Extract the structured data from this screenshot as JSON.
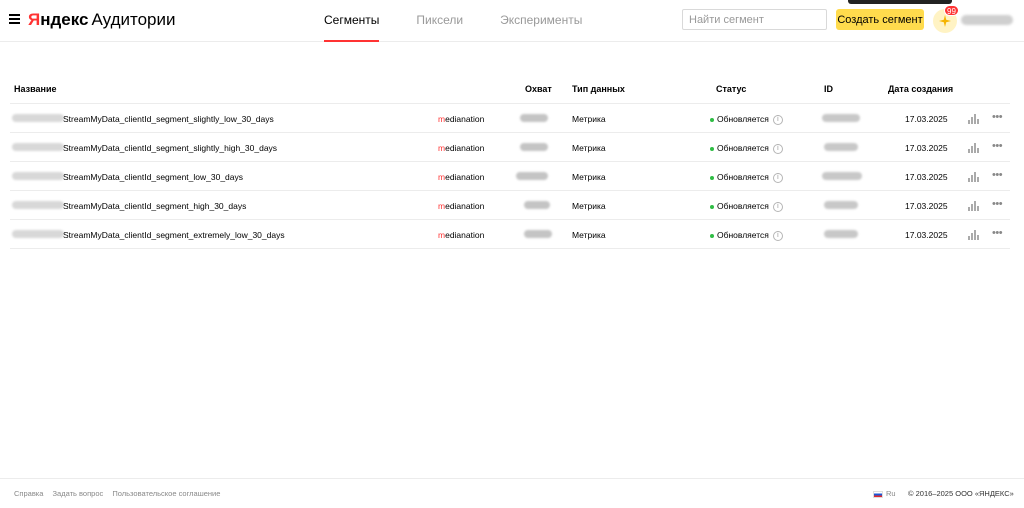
{
  "header": {
    "logo_brand_first": "Я",
    "logo_brand_rest": "ндекс",
    "logo_product": "Аудитории",
    "tabs": [
      {
        "label": "Сегменты",
        "active": true
      },
      {
        "label": "Пиксели",
        "active": false
      },
      {
        "label": "Эксперименты",
        "active": false
      }
    ],
    "search_placeholder": "Найти сегмент",
    "create_button": "Создать сегмент",
    "notification_count": "99"
  },
  "table": {
    "headers": {
      "name": "Название",
      "reach": "Охват",
      "data_type": "Тип данных",
      "status": "Статус",
      "id": "ID",
      "created": "Дата создания"
    },
    "rows": [
      {
        "name": "StreamMyData_clientId_segment_slightly_low_30_days",
        "owner_first": "m",
        "owner_rest": "edianation",
        "data_type": "Метрика",
        "status": "Обновляется",
        "date": "17.03.2025"
      },
      {
        "name": "StreamMyData_clientId_segment_slightly_high_30_days",
        "owner_first": "m",
        "owner_rest": "edianation",
        "data_type": "Метрика",
        "status": "Обновляется",
        "date": "17.03.2025"
      },
      {
        "name": "StreamMyData_clientId_segment_low_30_days",
        "owner_first": "m",
        "owner_rest": "edianation",
        "data_type": "Метрика",
        "status": "Обновляется",
        "date": "17.03.2025"
      },
      {
        "name": "StreamMyData_clientId_segment_high_30_days",
        "owner_first": "m",
        "owner_rest": "edianation",
        "data_type": "Метрика",
        "status": "Обновляется",
        "date": "17.03.2025"
      },
      {
        "name": "StreamMyData_clientId_segment_extremely_low_30_days",
        "owner_first": "m",
        "owner_rest": "edianation",
        "data_type": "Метрика",
        "status": "Обновляется",
        "date": "17.03.2025"
      }
    ],
    "info_glyph": "i"
  },
  "footer": {
    "links": [
      "Справка",
      "Задать вопрос",
      "Пользовательское соглашение"
    ],
    "language": "Ru",
    "copyright": "© 2016–2025 ООО «ЯНДЕКС»"
  },
  "colors": {
    "accent_red": "#f33",
    "button_yellow": "#ffdb4d",
    "status_green": "#2fbd44"
  }
}
